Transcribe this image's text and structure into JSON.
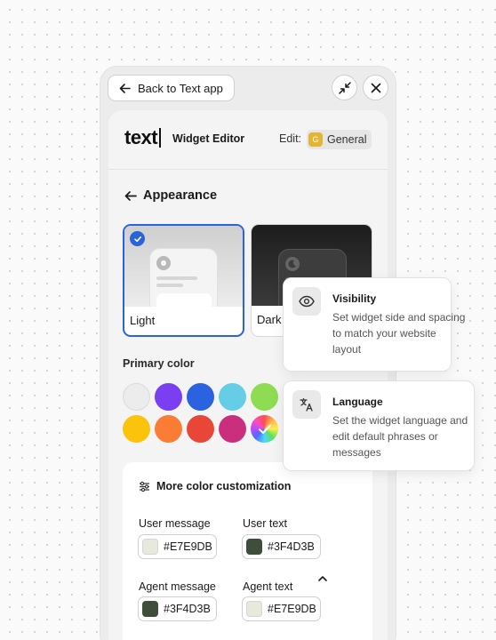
{
  "toolbar": {
    "back_label": "Back to Text app",
    "minimize_icon": "minimize-icon",
    "close_icon": "close-icon"
  },
  "header": {
    "logo": "text",
    "title": "Widget Editor",
    "edit_label": "Edit:",
    "edit_badge": "G",
    "edit_value": "General"
  },
  "appearance": {
    "title": "Appearance",
    "themes": [
      {
        "label": "Light",
        "selected": true
      },
      {
        "label": "Dark",
        "selected": false
      }
    ]
  },
  "primary_color": {
    "label": "Primary color",
    "swatches": [
      {
        "name": "none",
        "color": "#ececec"
      },
      {
        "name": "purple",
        "color": "#7b3ff2"
      },
      {
        "name": "blue",
        "color": "#2a62e0"
      },
      {
        "name": "cyan",
        "color": "#66cde6"
      },
      {
        "name": "green",
        "color": "#8ddc52"
      },
      {
        "name": "yellow",
        "color": "#fcc30d"
      },
      {
        "name": "orange",
        "color": "#fb7c35"
      },
      {
        "name": "red",
        "color": "#e84737"
      },
      {
        "name": "magenta",
        "color": "#c92f7d"
      },
      {
        "name": "custom",
        "color": "rainbow",
        "selected": true
      }
    ]
  },
  "more": {
    "title": "More color customization",
    "fields": [
      {
        "label": "User message",
        "value": "#E7E9DB",
        "color": "#E7E9DB"
      },
      {
        "label": "User text",
        "value": "#3F4D3B",
        "color": "#3F4D3B"
      },
      {
        "label": "Agent message",
        "value": "#3F4D3B",
        "color": "#3F4D3B"
      },
      {
        "label": "Agent text",
        "value": "#E7E9DB",
        "color": "#E7E9DB"
      }
    ]
  },
  "popups": [
    {
      "title": "Visibility",
      "text": "Set widget side and spacing to match your website layout",
      "icon": "eye-icon"
    },
    {
      "title": "Language",
      "text": "Set the widget language and edit default phrases or messages",
      "icon": "translate-icon"
    }
  ]
}
